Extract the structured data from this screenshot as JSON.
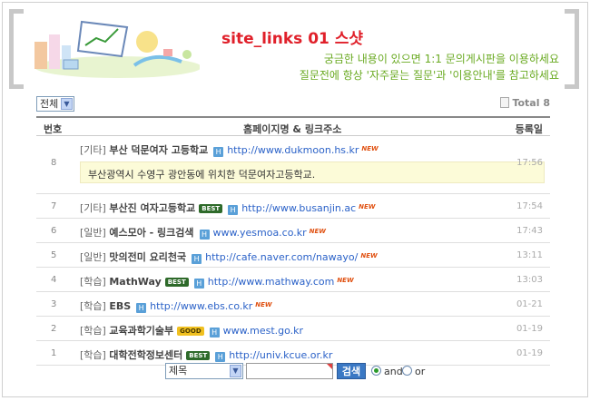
{
  "header": {
    "title": "site_links 01 스샷",
    "notice_line1": "궁금한 내용이 있으면 1:1 문의게시판을 이용하세요",
    "notice_line2": "질문전에 항상 '자주묻는 질문'과 '이용안내'를 참고하세요"
  },
  "toolbar": {
    "category_select": "전체",
    "total_label": "Total 8"
  },
  "columns": {
    "no": "번호",
    "main": "홈페이지명 & 링크주소",
    "date": "등록일"
  },
  "rows": [
    {
      "no": "8",
      "category": "[기타]",
      "site": "부산 덕문여자 고등학교",
      "url": "http://www.dukmoon.hs.kr",
      "badge": "",
      "new": "NEW",
      "date": "17:56",
      "description": "부산광역시 수영구 광안동에 위치한 덕문여자고등학교."
    },
    {
      "no": "7",
      "category": "[기타]",
      "site": "부산진 여자고등학교",
      "url": "http://www.busanjin.ac",
      "badge": "BEST",
      "new": "NEW",
      "date": "17:54"
    },
    {
      "no": "6",
      "category": "[일반]",
      "site": "예스모아 - 링크검색",
      "url": "www.yesmoa.co.kr",
      "badge": "",
      "new": "NEW",
      "date": "17:43"
    },
    {
      "no": "5",
      "category": "[일반]",
      "site": "맛의전미 요리천국",
      "url": "http://cafe.naver.com/nawayo/",
      "badge": "",
      "new": "NEW",
      "date": "13:11"
    },
    {
      "no": "4",
      "category": "[학습]",
      "site": "MathWay",
      "url": "http://www.mathway.com",
      "badge": "BEST",
      "new": "NEW",
      "date": "13:03"
    },
    {
      "no": "3",
      "category": "[학습]",
      "site": "EBS",
      "url": "http://www.ebs.co.kr",
      "badge": "",
      "new": "NEW",
      "date": "01-21"
    },
    {
      "no": "2",
      "category": "[학습]",
      "site": "교육과학기술부",
      "url": "www.mest.go.kr",
      "badge": "GOOD",
      "new": "",
      "date": "01-19"
    },
    {
      "no": "1",
      "category": "[학습]",
      "site": "대학전학정보센터",
      "url": "http://univ.kcue.or.kr",
      "badge": "BEST",
      "new": "",
      "date": "01-19"
    }
  ],
  "url_icon": "H",
  "search": {
    "field_select": "제목",
    "query": "",
    "button_label": "검색",
    "and_label": "and",
    "or_label": "or",
    "mode": "and"
  },
  "icons": [
    "homepage-link-icon",
    "document-icon",
    "dropdown-arrow-icon"
  ]
}
